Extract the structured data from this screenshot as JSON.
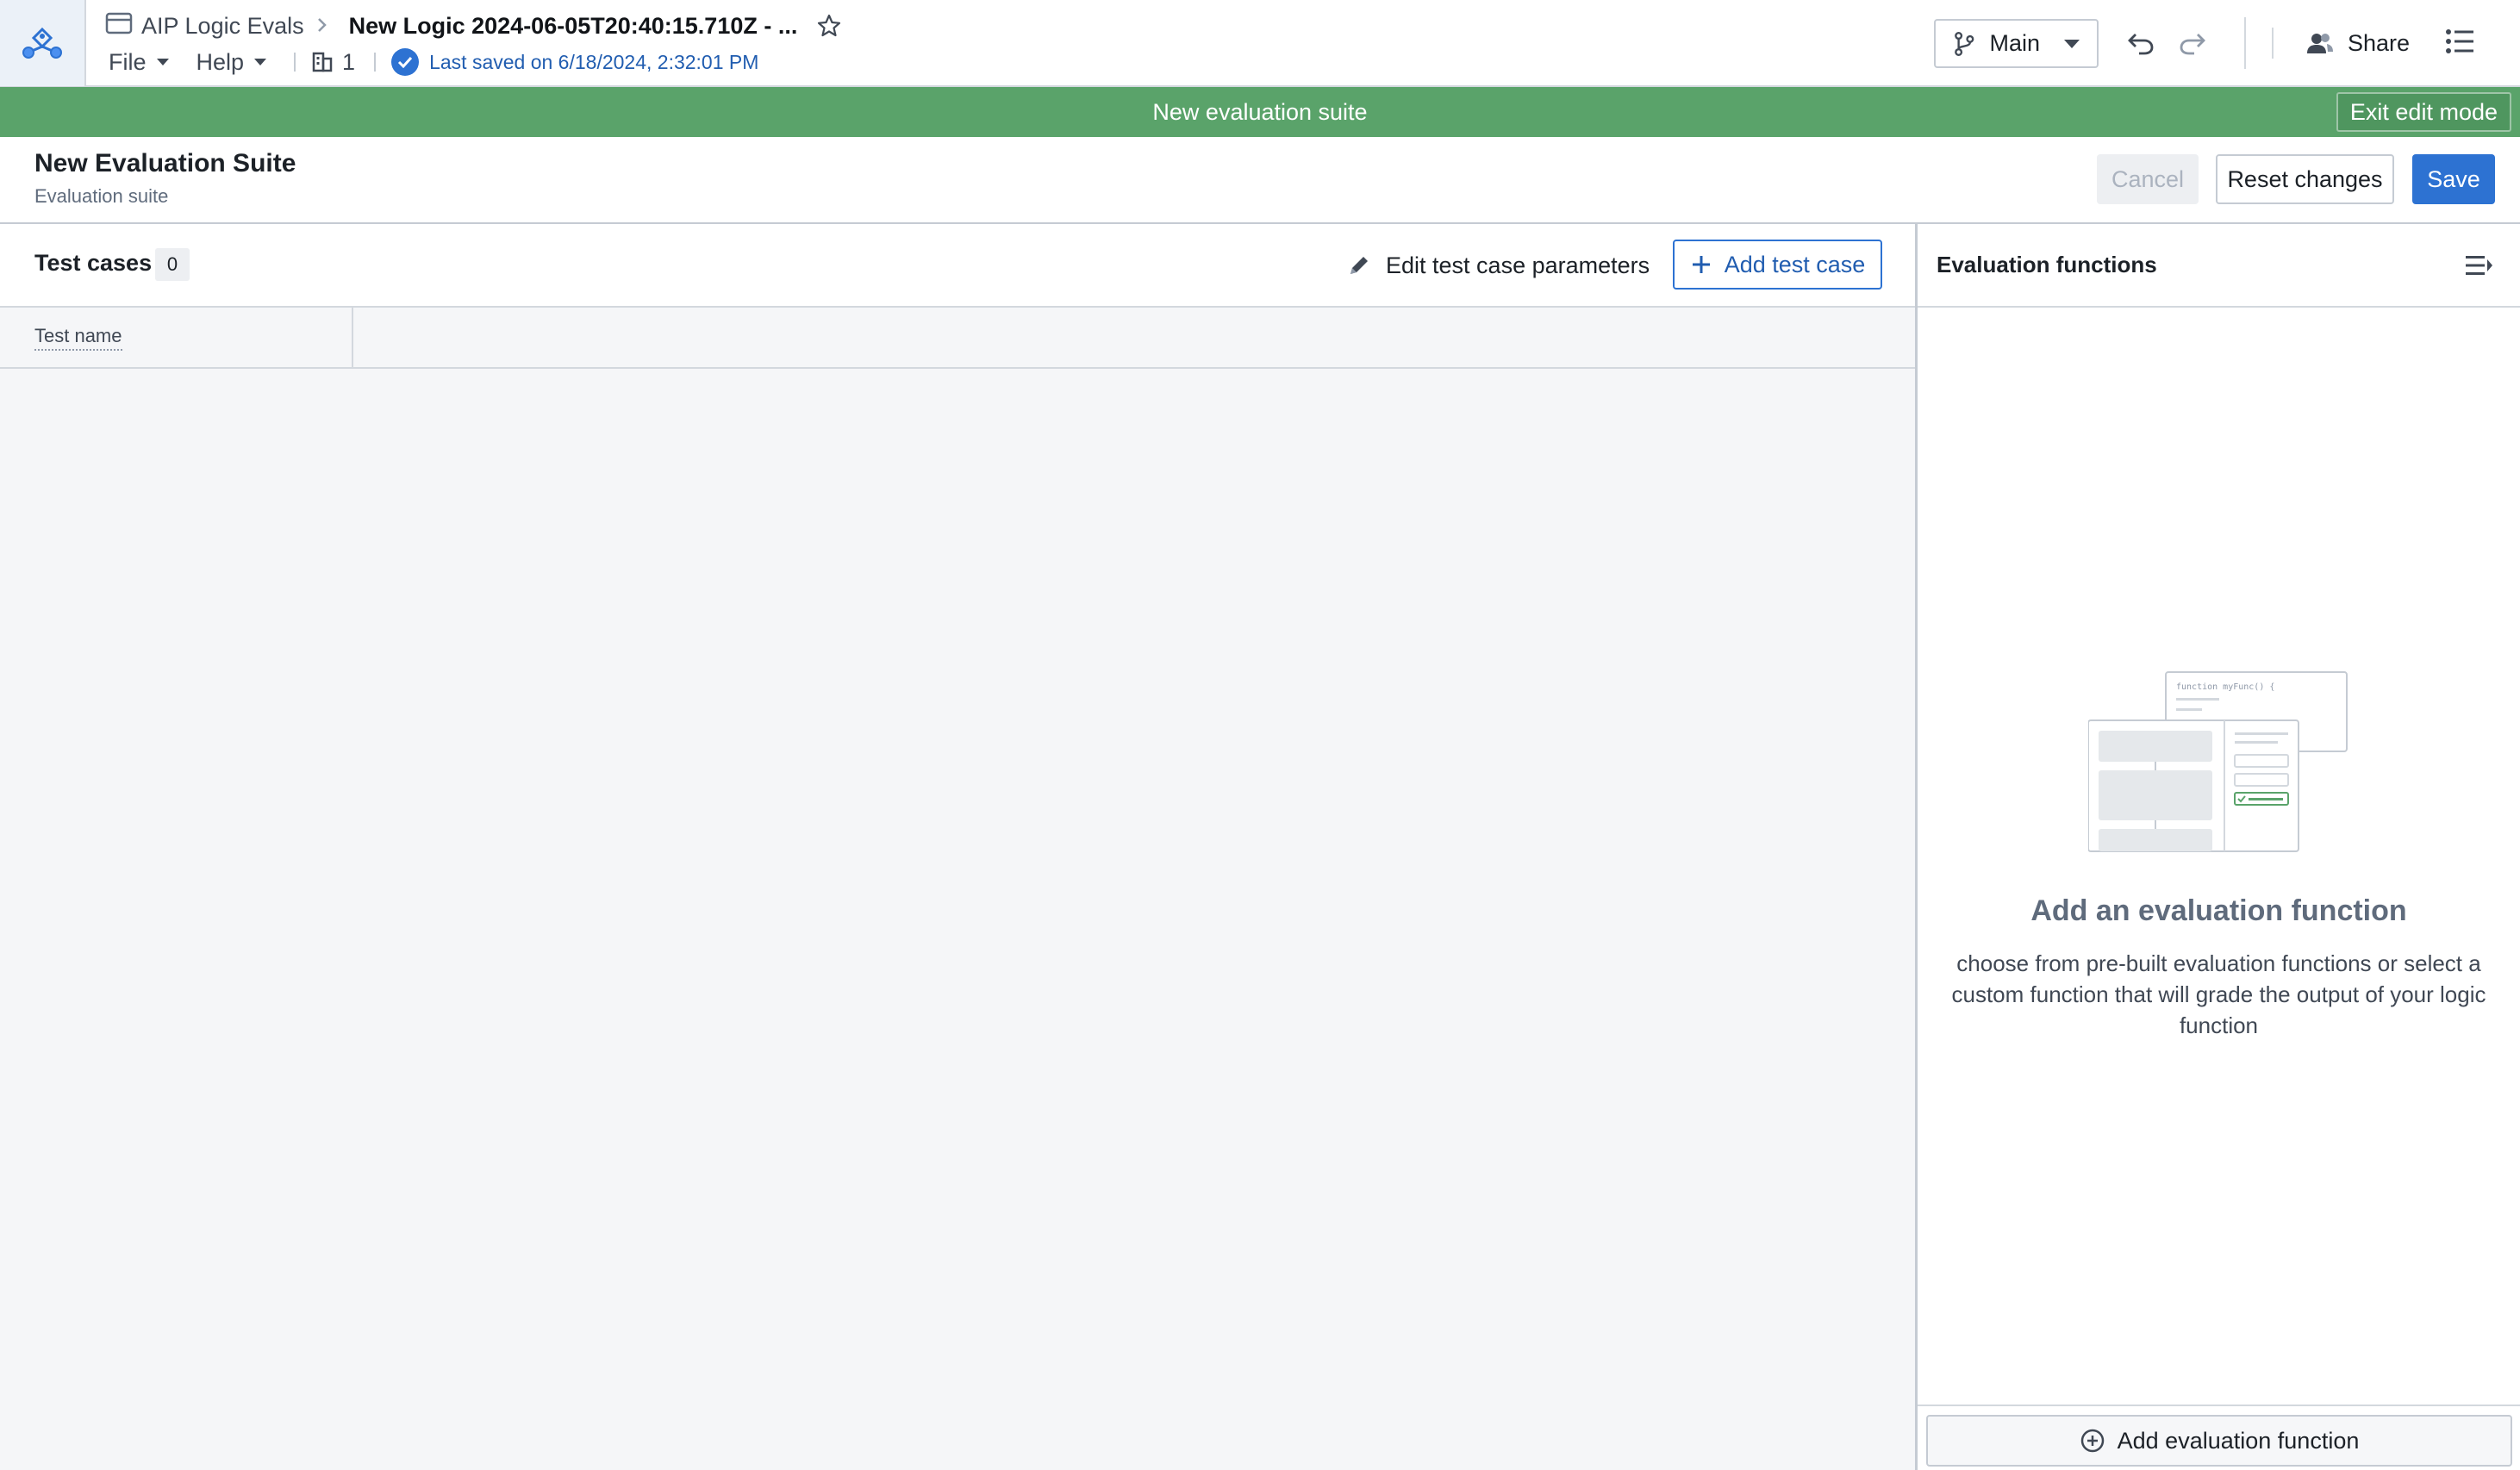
{
  "header": {
    "breadcrumb_parent": "AIP Logic Evals",
    "breadcrumb_separator": ">",
    "title": "New Logic 2024-06-05T20:40:15.710Z - ...",
    "menus": [
      "File",
      "Help"
    ],
    "builds_count": "1",
    "save_status": "Last saved on 6/18/2024, 2:32:01 PM",
    "branch": "Main",
    "share_label": "Share"
  },
  "banner": {
    "text": "New evaluation suite",
    "exit_label": "Exit edit mode"
  },
  "suite": {
    "title": "New Evaluation Suite",
    "subtitle": "Evaluation suite",
    "cancel_label": "Cancel",
    "reset_label": "Reset changes",
    "save_label": "Save"
  },
  "test_cases": {
    "title": "Test cases",
    "count": "0",
    "edit_params_label": "Edit test case parameters",
    "add_label": "Add test case",
    "columns": [
      "Test name"
    ],
    "rows": []
  },
  "eval_functions": {
    "title": "Evaluation functions",
    "illustration_code": "function myFunc() {",
    "empty_title": "Add an evaluation function",
    "empty_description": "choose from pre-built evaluation functions or select a custom function that will grade the output of your logic function",
    "add_label": "Add evaluation function"
  },
  "colors": {
    "accent": "#2d72d2",
    "banner": "#5aa36a",
    "border": "#d3d8de"
  }
}
